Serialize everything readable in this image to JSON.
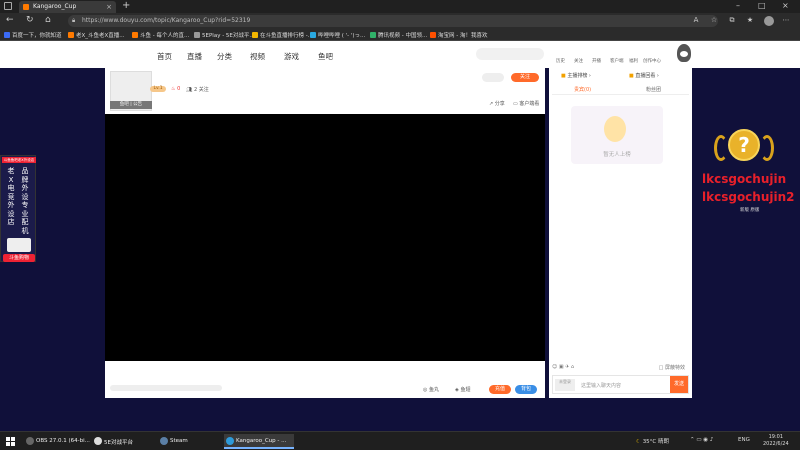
{
  "browser": {
    "tab_title": "Kangaroo_Cup",
    "new_tab": "+",
    "url": "https://www.douyu.com/topic/Kangaroo_Cup?rid=52319",
    "bookmarks": [
      "百度一下，你就知道",
      "老X_斗鱼老X直播...",
      "斗鱼 - 每个人的直...",
      "5EPlay - 5E对战平...",
      "在斗鱼直播排行榜 -...",
      "哔哩哔哩 ( '- ')っ...",
      "腾讯视频 - 中国领...",
      "淘宝网 - 淘！我喜欢"
    ]
  },
  "site": {
    "nav": [
      "首页",
      "直播",
      "分类",
      "视频",
      "游戏",
      "鱼吧"
    ],
    "links": [
      "历史",
      "关注",
      "开播",
      "客户端",
      "福利",
      "创作中心"
    ]
  },
  "player": {
    "thumb_label": "鱼吧 | 公告",
    "level": "Lv.1",
    "heat": "0",
    "fans": "2 关注",
    "follow": "关注",
    "share": "分享",
    "client": "客户端看",
    "gift1": "鱼丸",
    "gift2": "鱼翅",
    "fire_btn": "充值",
    "blue_btn": "背包"
  },
  "sidebar": {
    "rank_left": "主播排榜 ›",
    "rank_right": "直播回看 ›",
    "subtab_left": "贵宾(0)",
    "subtab_right": "粉丝团",
    "empty_text": "暂无人上榜",
    "chat_toggle": "屏蔽特效",
    "chat_placeholder": "这里输入聊天内容",
    "chat_avatar": "未登录",
    "send": "发送"
  },
  "left_ad": {
    "top": "斗鱼鱼吧老X外设店",
    "col1": "老X电竞外设店",
    "col2": "品牌外设专业配机",
    "shop": "斗鱼购物"
  },
  "overlay": {
    "badge_symbol": "?",
    "name1": "lkcsgochujin",
    "name2": "lkcsgochujin2",
    "name_sub": "新版 原版 "
  },
  "taskbar": {
    "apps": [
      "OBS 27.0.1 (64-bi...",
      "5E对战平台",
      "Steam",
      "Kangaroo_Cup - ..."
    ],
    "temp": "35°C",
    "weather": "晴朗",
    "lang": "ENG",
    "time": "19:01",
    "date": "2022/6/24"
  },
  "colors": {
    "accent": "#ff6a2a",
    "page_bg": "#10103a",
    "name": "#e8202a"
  }
}
